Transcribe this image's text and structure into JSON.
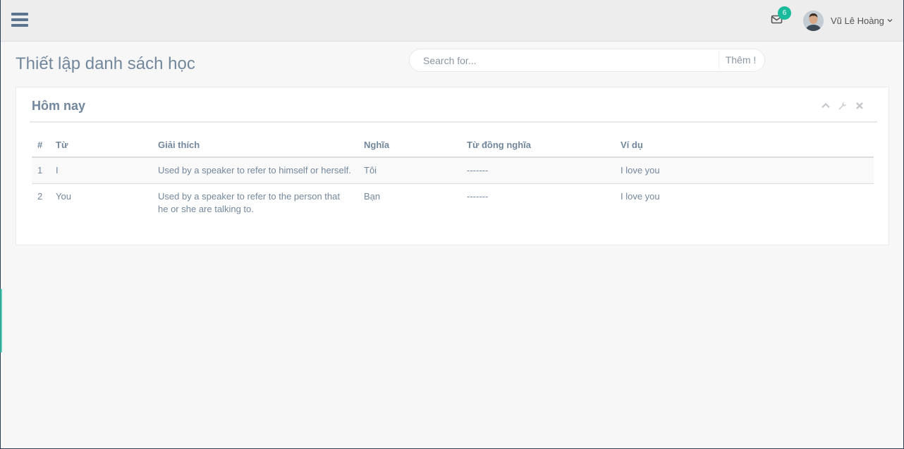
{
  "header": {
    "notifications_count": "6",
    "user_name": "Vũ Lê Hoàng",
    "icons": [
      "menu-icon",
      "envelope-icon",
      "avatar",
      "chevron-down-icon"
    ]
  },
  "page": {
    "title": "Thiết lập danh sách học"
  },
  "search": {
    "placeholder": "Search for...",
    "button_label": "Thêm !"
  },
  "panel": {
    "title": "Hôm nay",
    "tools": [
      "chevron-up-icon",
      "wrench-icon",
      "close-icon"
    ]
  },
  "table": {
    "headers": [
      "#",
      "Từ",
      "Giải thích",
      "Nghĩa",
      "Từ đồng nghĩa",
      "Ví dụ"
    ],
    "rows": [
      [
        "1",
        "I",
        "Used by a speaker to refer to himself or herself.",
        "Tôi",
        "-------",
        "I love you"
      ],
      [
        "2",
        "You",
        "Used by a speaker to refer to the person that he or she are talking to.",
        "Bạn",
        "-------",
        "I love you"
      ]
    ]
  },
  "colors": {
    "accent": "#1ABB9C",
    "text": "#73879C",
    "topbar": "#EDEDED",
    "background": "#F7F7F7"
  }
}
